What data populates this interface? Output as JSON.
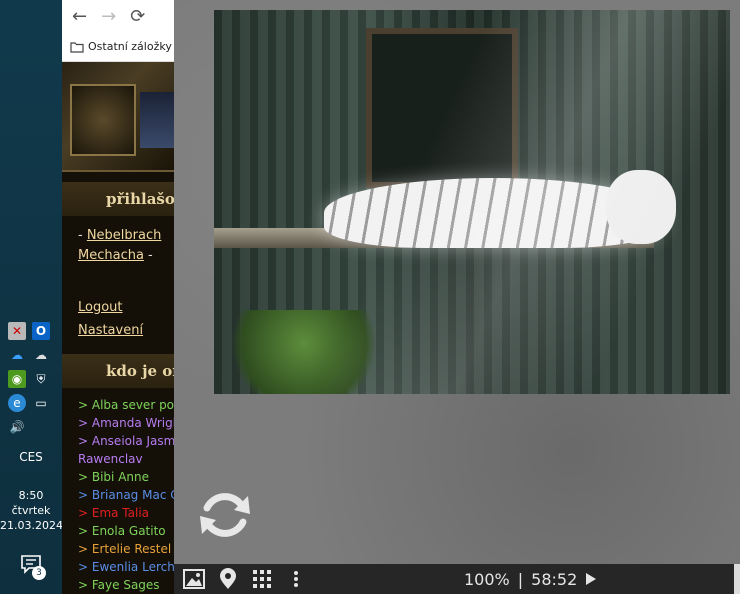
{
  "browser": {
    "nav": {
      "back": "←",
      "forward": "→",
      "reload": "⟳"
    },
    "bookmarks_label": "Ostatní záložky"
  },
  "page": {
    "login_title": "přihlašov",
    "user_line_prefix": "- ",
    "user_name_1": "Nebelbrach",
    "user_name_2": "Mechacha",
    "user_line_suffix": " -",
    "logout": "Logout",
    "settings": "Nastavení",
    "online_title": "kdo je onl",
    "online_users": [
      {
        "text": "> Alba sever pota",
        "color": "#7fd35a"
      },
      {
        "text": "> Amanda Wrigh",
        "color": "#b77cf0"
      },
      {
        "text": "> Anseiola Jasmi",
        "color": "#b77cf0"
      },
      {
        "text": "Rawenclav",
        "color": "#b77cf0"
      },
      {
        "text": "> Bibi Anne",
        "color": "#7fd35a"
      },
      {
        "text": "> Brianag Mac C",
        "color": "#5a8ee6"
      },
      {
        "text": "> Ema Talia",
        "color": "#e02020"
      },
      {
        "text": "> Enola Gatito",
        "color": "#7fd35a"
      },
      {
        "text": "> Ertelie Restel",
        "color": "#e8a23a"
      },
      {
        "text": "> Ewenlia Lerche",
        "color": "#5a8ee6"
      },
      {
        "text": "> Faye Sages",
        "color": "#7fd35a"
      }
    ]
  },
  "taskbar": {
    "language": "CES",
    "time": "8:50",
    "day": "čtvrtek",
    "date": "21.03.2024",
    "notification_count": "3"
  },
  "viewer": {
    "zoom": "100%",
    "separator": "|",
    "time": "58:52"
  }
}
